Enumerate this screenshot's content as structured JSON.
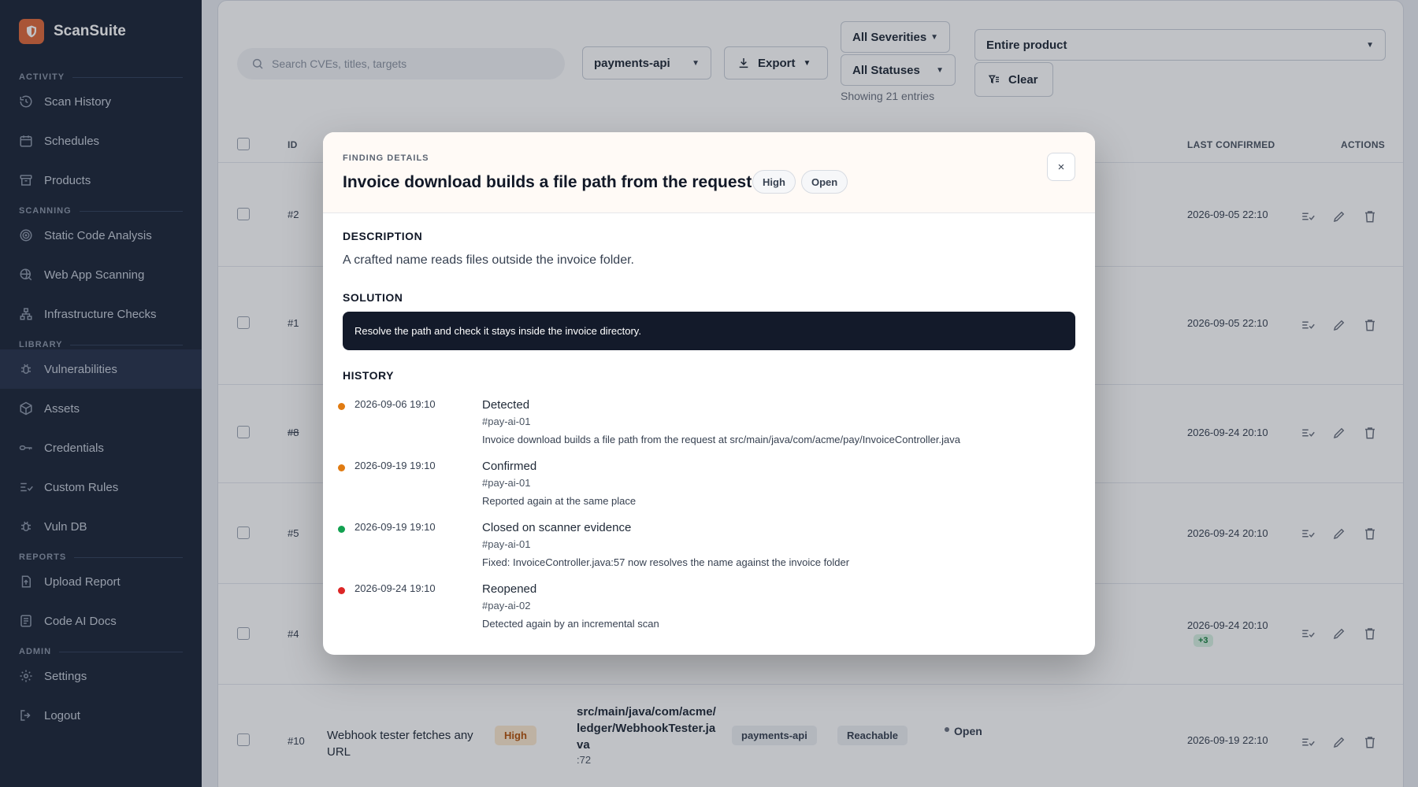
{
  "app": {
    "name": "ScanSuite"
  },
  "sidebar": {
    "sections": [
      {
        "title": "ACTIVITY",
        "items": [
          {
            "label": "Scan History",
            "icon": "history-icon"
          },
          {
            "label": "Schedules",
            "icon": "calendar-icon"
          },
          {
            "label": "Products",
            "icon": "archive-icon"
          }
        ]
      },
      {
        "title": "SCANNING",
        "items": [
          {
            "label": "Static Code Analysis",
            "icon": "target-icon"
          },
          {
            "label": "Web App Scanning",
            "icon": "globe-search-icon"
          },
          {
            "label": "Infrastructure Checks",
            "icon": "network-icon"
          }
        ]
      },
      {
        "title": "LIBRARY",
        "items": [
          {
            "label": "Vulnerabilities",
            "icon": "bug-icon"
          },
          {
            "label": "Assets",
            "icon": "box-icon"
          },
          {
            "label": "Credentials",
            "icon": "key-icon"
          },
          {
            "label": "Custom Rules",
            "icon": "list-check-icon"
          },
          {
            "label": "Vuln DB",
            "icon": "bug-icon"
          }
        ]
      },
      {
        "title": "REPORTS",
        "items": [
          {
            "label": "Upload Report",
            "icon": "upload-icon"
          },
          {
            "label": "Code AI Docs",
            "icon": "document-icon"
          }
        ]
      },
      {
        "title": "ADMIN",
        "items": [
          {
            "label": "Settings",
            "icon": "gear-icon"
          },
          {
            "label": "Logout",
            "icon": "logout-icon"
          }
        ]
      }
    ]
  },
  "toolbar": {
    "search_placeholder": "Search CVEs, titles, targets",
    "product_select": "payments-api",
    "export_label": "Export",
    "severity_select": "All Severities",
    "status_select": "All Statuses",
    "scope_select": "Entire product",
    "clear_label": "Clear",
    "showing": "Showing 21 entries"
  },
  "table": {
    "headers": {
      "id": "ID",
      "last_confirmed": "LAST CONFIRMED",
      "actions": "ACTIONS"
    },
    "rows": [
      {
        "id": "#2",
        "date": "2026-09-05 22:10"
      },
      {
        "id": "#1",
        "date": "2026-09-05 22:10"
      },
      {
        "id": "#8",
        "date": "2026-09-24 20:10"
      },
      {
        "id": "#5",
        "date": "2026-09-24 20:10"
      },
      {
        "id": "#4",
        "date": "2026-09-24 20:10",
        "extra": "+3"
      },
      {
        "id": "#10",
        "date": "2026-09-19 22:10",
        "title": "Webhook tester fetches any URL",
        "severity": "High",
        "file": "src/main/java/com/acme/ledger/WebhookTester.java",
        "line": ":72",
        "product": "payments-api",
        "reach": "Reachable",
        "status": "Open"
      }
    ]
  },
  "modal": {
    "eyebrow": "FINDING DETAILS",
    "title": "Invoice download builds a file path from the request",
    "severity": "High",
    "status": "Open",
    "close_label": "×",
    "description_heading": "DESCRIPTION",
    "description": "A crafted name reads files outside the invoice folder.",
    "solution_heading": "SOLUTION",
    "solution": "Resolve the path and check it stays inside the invoice directory.",
    "history_heading": "HISTORY",
    "history": [
      {
        "date": "2026-09-06 19:10",
        "event": "Detected",
        "ref": "#pay-ai-01",
        "detail": "Invoice download builds a file path from the request at src/main/java/com/acme/pay/InvoiceController.java",
        "color": "#e07b12"
      },
      {
        "date": "2026-09-19 19:10",
        "event": "Confirmed",
        "ref": "#pay-ai-01",
        "detail": "Reported again at the same place",
        "color": "#e07b12"
      },
      {
        "date": "2026-09-19 19:10",
        "event": "Closed on scanner evidence",
        "ref": "#pay-ai-01",
        "detail": "Fixed: InvoiceController.java:57 now resolves the name against the invoice folder",
        "color": "#12a150"
      },
      {
        "date": "2026-09-24 19:10",
        "event": "Reopened",
        "ref": "#pay-ai-02",
        "detail": "Detected again by an incremental scan",
        "color": "#dc2626"
      }
    ]
  }
}
